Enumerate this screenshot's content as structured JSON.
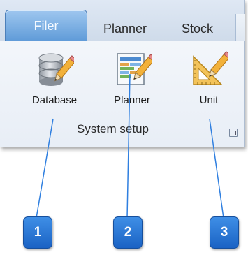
{
  "ribbon": {
    "tabs": [
      {
        "label": "Filer",
        "active": true
      },
      {
        "label": "Planner",
        "active": false
      },
      {
        "label": "Stock",
        "active": false
      }
    ],
    "buttons": {
      "database": {
        "label": "Database",
        "icon": "database-edit-icon"
      },
      "planner": {
        "label": "Planner",
        "icon": "planner-edit-icon"
      },
      "unit": {
        "label": "Unit",
        "icon": "unit-ruler-icon"
      }
    },
    "group_label": "System setup",
    "launcher_icon": "dialog-launcher-icon"
  },
  "callouts": [
    {
      "number": "1"
    },
    {
      "number": "2"
    },
    {
      "number": "3"
    }
  ],
  "colors": {
    "callout_blue": "#1f6fd6",
    "file_tab": "#6fa6df"
  }
}
